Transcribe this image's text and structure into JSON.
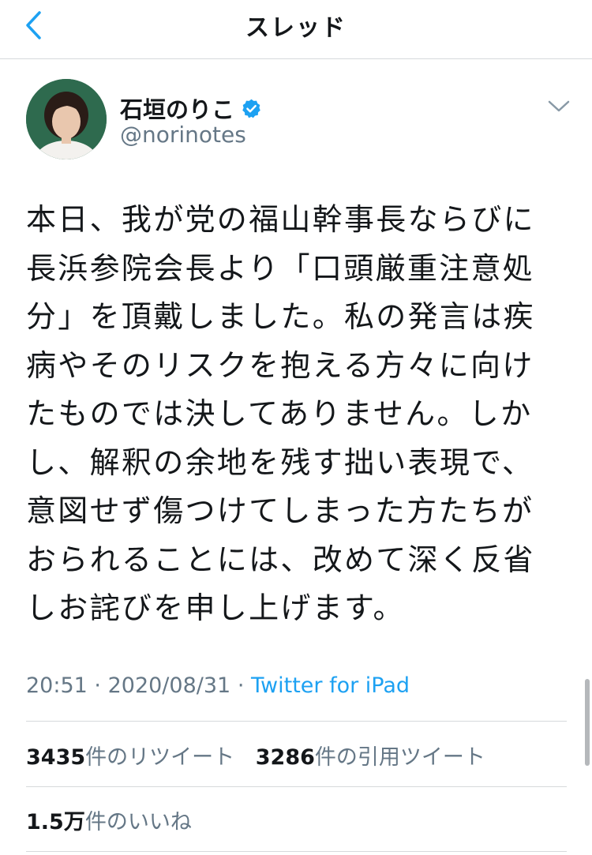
{
  "nav": {
    "title": "スレッド",
    "back_icon": "chevron-left-icon"
  },
  "colors": {
    "accent": "#1da1f2",
    "text": "#14171a",
    "secondary": "#657786",
    "divider": "#d6d9db"
  },
  "tweet": {
    "author": {
      "name": "石垣のりこ",
      "handle": "@norinotes",
      "verified": true
    },
    "text_lines": [
      "本日、我が党の福山幹事長ならびに",
      "長浜参院会長より「口頭厳重注意処",
      "分」を頂戴しました。私の発言は疾",
      "病やそのリスクを抱える方々に向け",
      "たものでは決してありません。しか",
      "し、解釈の余地を残す拙い表現で、",
      "意図せず傷つけてしまった方たちが",
      "おられることには、改めて深く反省",
      "しお詫びを申し上げます。"
    ],
    "time": "20:51",
    "separator": "·",
    "date": "2020/08/31",
    "source": "Twitter for iPad",
    "retweets": {
      "count": "3435",
      "label": "件のリツイート"
    },
    "quotes": {
      "count": "3286",
      "label": "件の引用ツイート"
    },
    "likes": {
      "count": "1.5万",
      "label": "件のいいね"
    }
  }
}
